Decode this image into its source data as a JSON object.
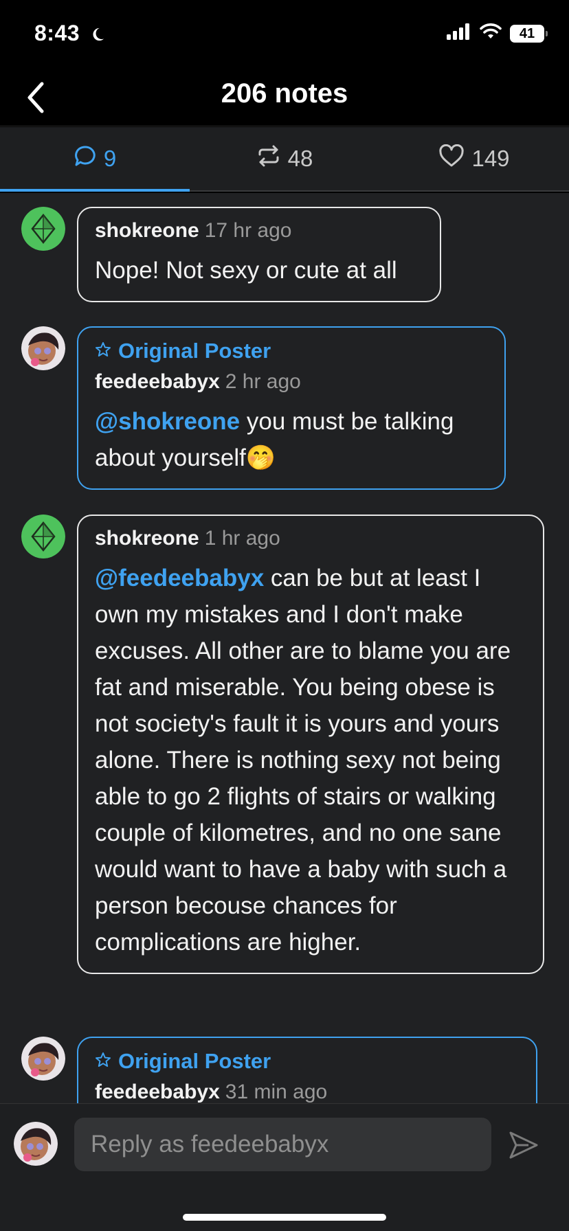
{
  "status_bar": {
    "time": "8:43",
    "battery": "41"
  },
  "header": {
    "title": "206 notes"
  },
  "tabs": [
    {
      "icon": "comment-icon",
      "label": "9",
      "active": true
    },
    {
      "icon": "reblog-icon",
      "label": "48",
      "active": false
    },
    {
      "icon": "heart-icon",
      "label": "149",
      "active": false
    }
  ],
  "notes": [
    {
      "username": "shokreone",
      "time": "17 hr ago",
      "text": "Nope! Not sexy or cute at all"
    },
    {
      "op_label": "Original Poster",
      "username": "feedeebabyx",
      "time": "2 hr ago",
      "mention": "@shokreone",
      "text": " you must be talking about yourself🤭"
    },
    {
      "username": "shokreone",
      "time": "1 hr ago",
      "mention": "@feedeebabyx",
      "text": " can be but at least I own my mistakes and I don't make excuses. All other are to blame you are fat and miserable. You being obese is not society's fault it is yours and yours alone. There is nothing sexy not being able to go 2 flights of stairs or walking couple of kilometres, and no one sane would want to have a baby with such a person becouse chances for complications are higher."
    },
    {
      "op_label": "Original Poster",
      "username": "feedeebabyx",
      "time": "31 min ago"
    }
  ],
  "composer": {
    "placeholder": "Reply as feedeebabyx"
  },
  "colors": {
    "accent": "#3fa2f0",
    "avatar_green": "#4ec25c",
    "background": "#202123"
  }
}
